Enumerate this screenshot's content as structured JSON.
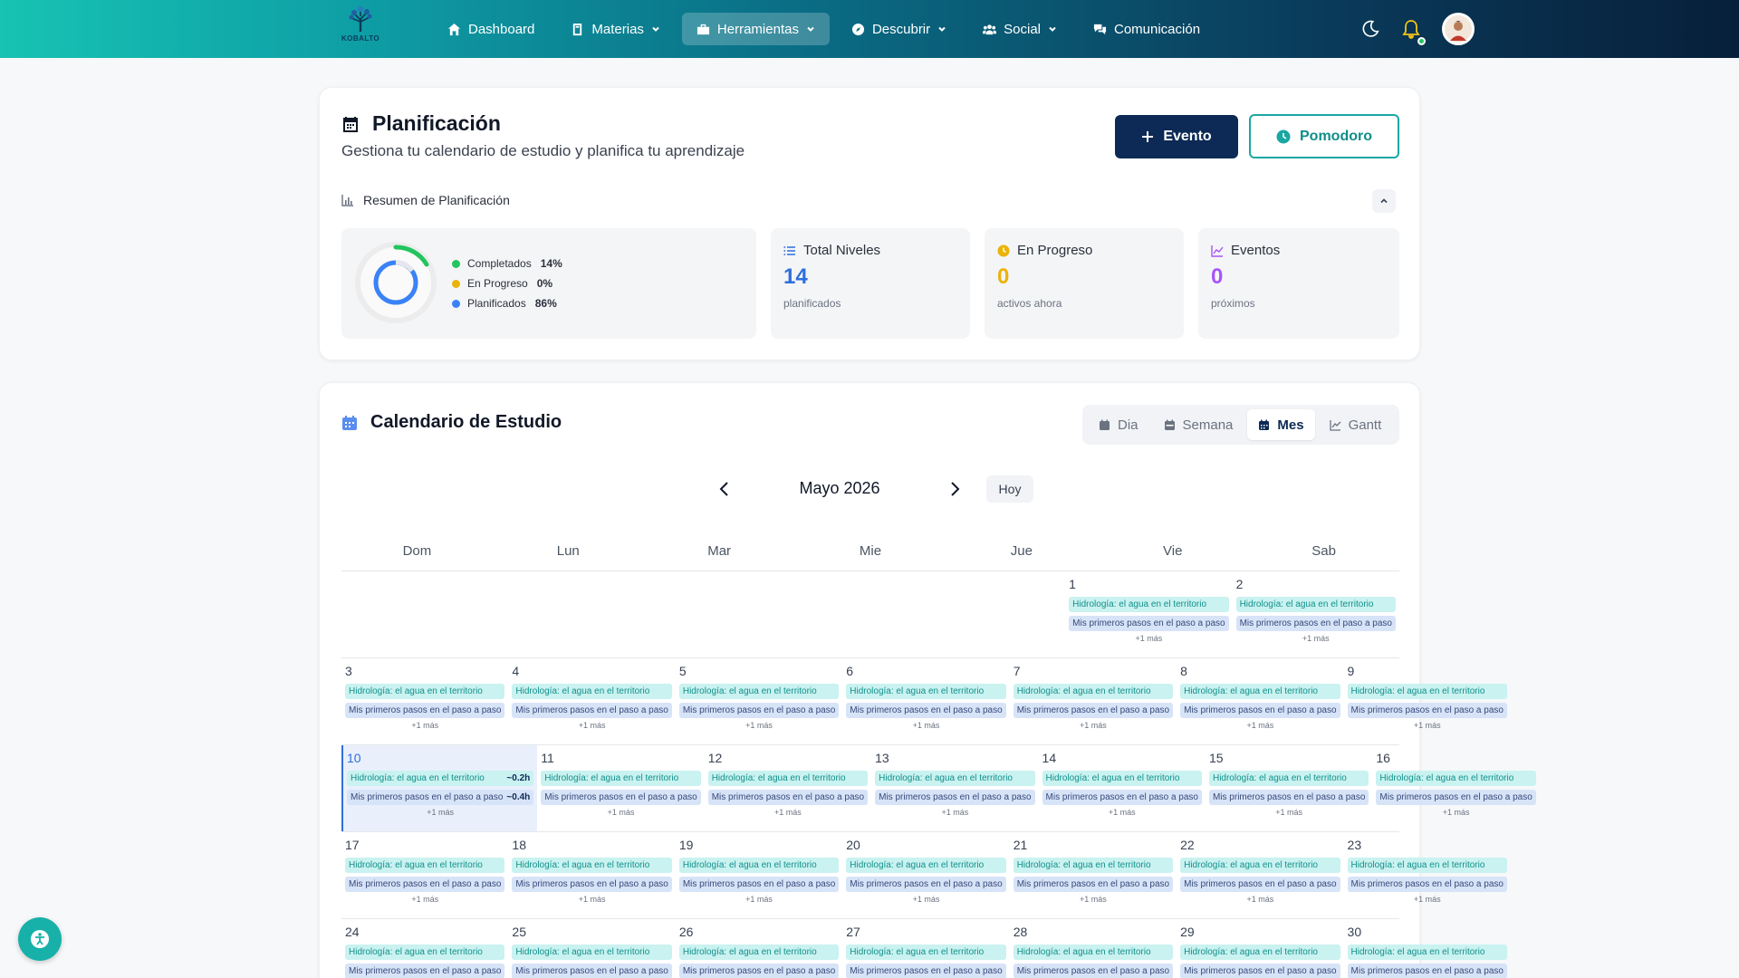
{
  "nav": {
    "logo_text": "KOBALTO",
    "items": [
      {
        "label": "Dashboard",
        "icon": "home-icon",
        "has_menu": false,
        "active": false
      },
      {
        "label": "Materias",
        "icon": "book-icon",
        "has_menu": true,
        "active": false
      },
      {
        "label": "Herramientas",
        "icon": "toolbox-icon",
        "has_menu": true,
        "active": true
      },
      {
        "label": "Descubrir",
        "icon": "compass-icon",
        "has_menu": true,
        "active": false
      },
      {
        "label": "Social",
        "icon": "users-icon",
        "has_menu": true,
        "active": false
      },
      {
        "label": "Comunicación",
        "icon": "chat-icon",
        "has_menu": false,
        "active": false
      }
    ]
  },
  "planning": {
    "title": "Planificación",
    "subtitle": "Gestiona tu calendario de estudio y planifica tu aprendizaje",
    "btn_event": "Evento",
    "btn_pomodoro": "Pomodoro",
    "summary_title": "Resumen de Planificación",
    "donut": {
      "legend": [
        {
          "label": "Completados",
          "pct": "14%",
          "color": "#22c55e"
        },
        {
          "label": "En Progreso",
          "pct": "0%",
          "color": "#eab308"
        },
        {
          "label": "Planificados",
          "pct": "86%",
          "color": "#3b82f6"
        }
      ]
    },
    "stats": {
      "total": {
        "label": "Total Niveles",
        "value": "14",
        "note": "planificados",
        "color": "#2f6fdc"
      },
      "progress": {
        "label": "En Progreso",
        "value": "0",
        "note": "activos ahora",
        "color": "#eab308"
      },
      "events": {
        "label": "Eventos",
        "value": "0",
        "note": "próximos",
        "color": "#a855f7"
      }
    }
  },
  "calendar": {
    "title": "Calendario de Estudio",
    "views": [
      "Dia",
      "Semana",
      "Mes",
      "Gantt"
    ],
    "active_view": "Mes",
    "month_label": "Mayo 2026",
    "today_label": "Hoy",
    "days_of_week": [
      "Dom",
      "Lun",
      "Mar",
      "Mie",
      "Jue",
      "Vie",
      "Sab"
    ],
    "event_a": "Hidrología: el agua en el territorio",
    "event_b": "Mis primeros pasos en el paso a paso",
    "more_label": "+1 más",
    "today_day": 10,
    "today_durations": [
      "~0.2h",
      "~0.4h"
    ],
    "weeks": [
      [
        "",
        "",
        "",
        "",
        "",
        "1",
        "2"
      ],
      [
        "3",
        "4",
        "5",
        "6",
        "7",
        "8",
        "9"
      ],
      [
        "10",
        "11",
        "12",
        "13",
        "14",
        "15",
        "16"
      ],
      [
        "17",
        "18",
        "19",
        "20",
        "21",
        "22",
        "23"
      ],
      [
        "24",
        "25",
        "26",
        "27",
        "28",
        "29",
        "30"
      ]
    ]
  }
}
